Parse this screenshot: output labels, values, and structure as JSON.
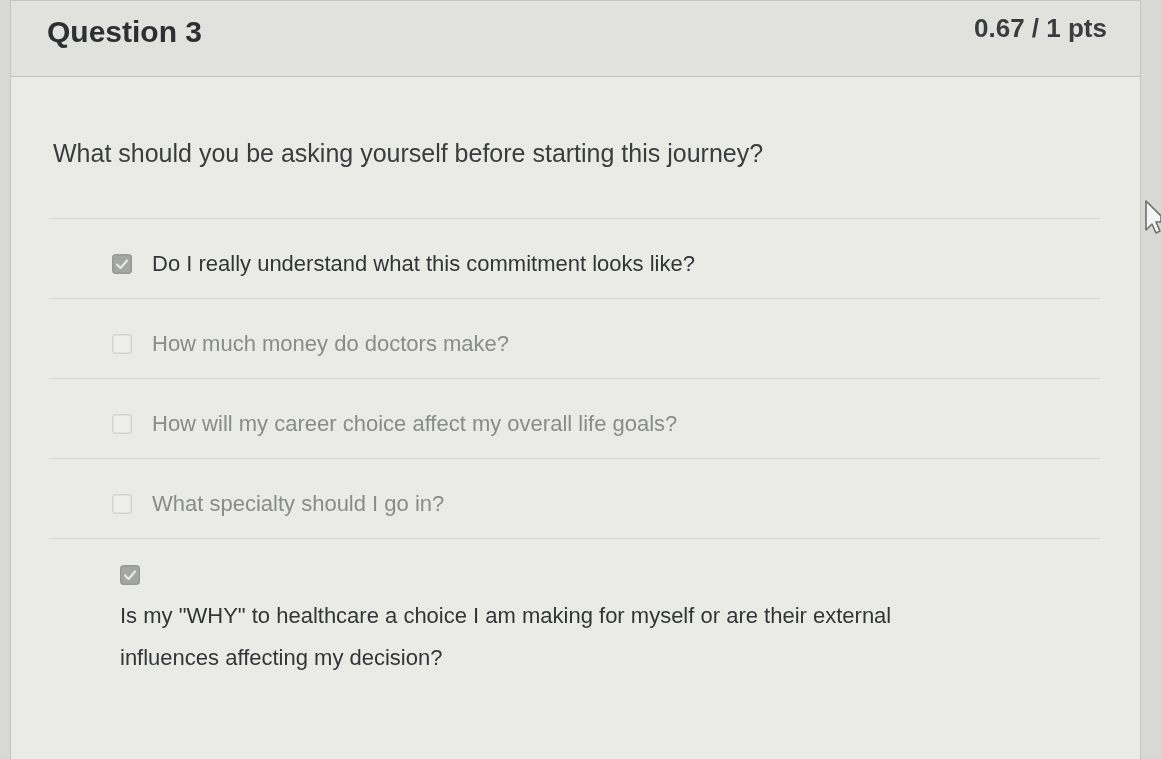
{
  "question": {
    "title": "Question 3",
    "score": "0.67 / 1 pts",
    "text": "What should you be asking yourself before starting this journey?",
    "answers": [
      {
        "label": "Do I really understand what this commitment looks like?",
        "checked": true,
        "kind": "inline"
      },
      {
        "label": "How much money do doctors make?",
        "checked": false,
        "kind": "inline"
      },
      {
        "label": "How will my career choice affect my overall life goals?",
        "checked": false,
        "kind": "inline"
      },
      {
        "label": "What specialty should I go in?",
        "checked": false,
        "kind": "inline"
      },
      {
        "label": "Is my \"WHY\" to healthcare a choice I am making for myself or are their external influences affecting my decision?",
        "checked": true,
        "kind": "stacked"
      }
    ]
  }
}
